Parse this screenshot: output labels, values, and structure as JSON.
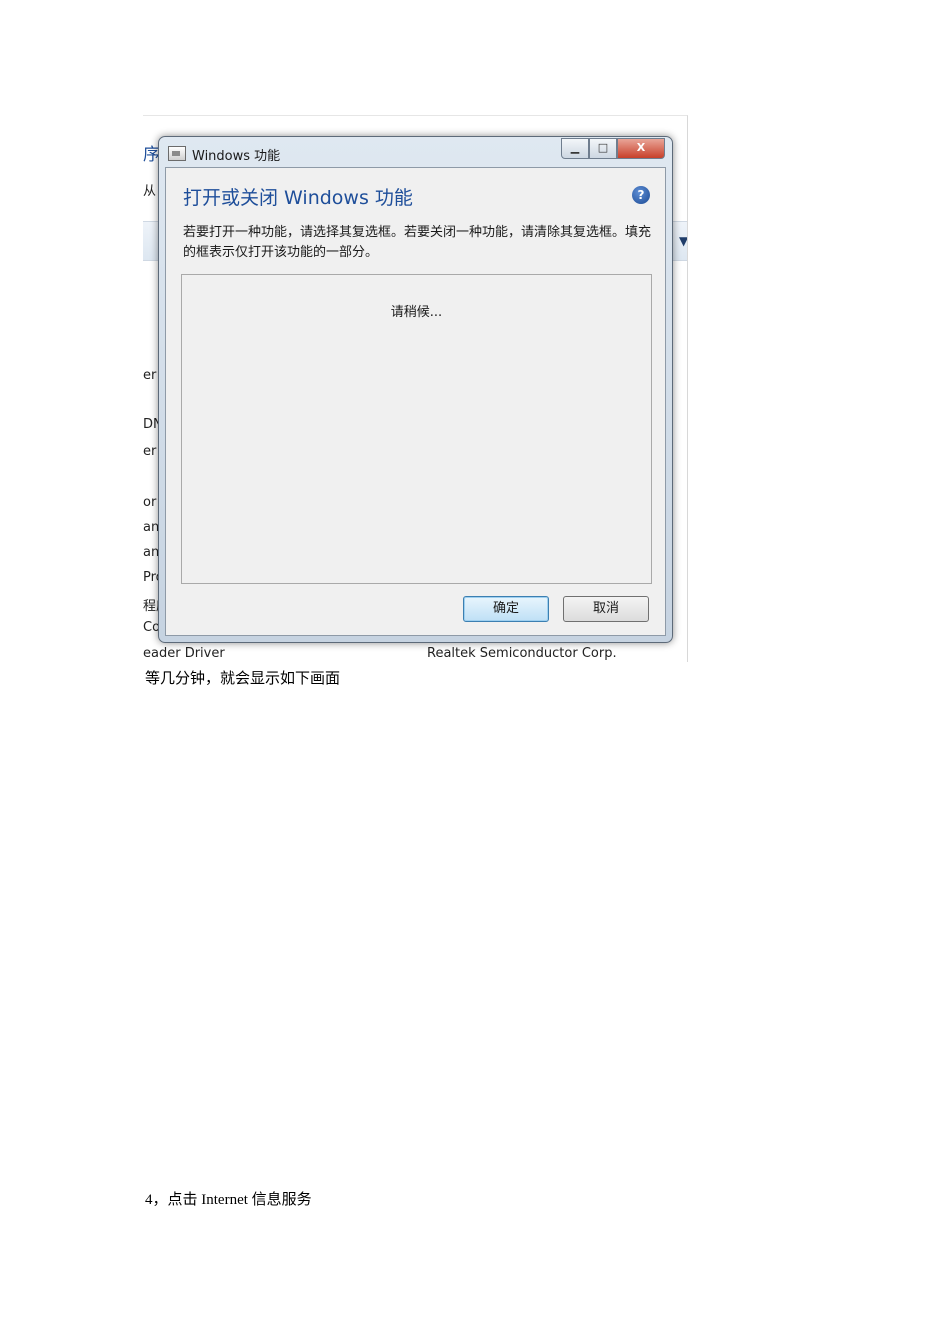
{
  "background": {
    "left_fragments": [
      "序",
      "从",
      "er",
      "DN",
      "er",
      "or",
      "an",
      "an",
      "Pro",
      "程序",
      "Co"
    ],
    "bottom_left": "eader Driver",
    "bottom_right": "Realtek Semiconductor Corp."
  },
  "dialog": {
    "title": "Windows 功能",
    "heading": "打开或关闭 Windows 功能",
    "description": "若要打开一种功能，请选择其复选框。若要关闭一种功能，请清除其复选框。填充的框表示仅打开该功能的一部分。",
    "loading_text": "请稍候...",
    "ok_label": "确定",
    "cancel_label": "取消",
    "minimize_glyph": "▁",
    "maximize_glyph": "□",
    "close_glyph": "X",
    "help_glyph": "?"
  },
  "doc": {
    "caption": "等几分钟，就会显示如下画面",
    "step": "4，点击  Internet 信息服务"
  }
}
